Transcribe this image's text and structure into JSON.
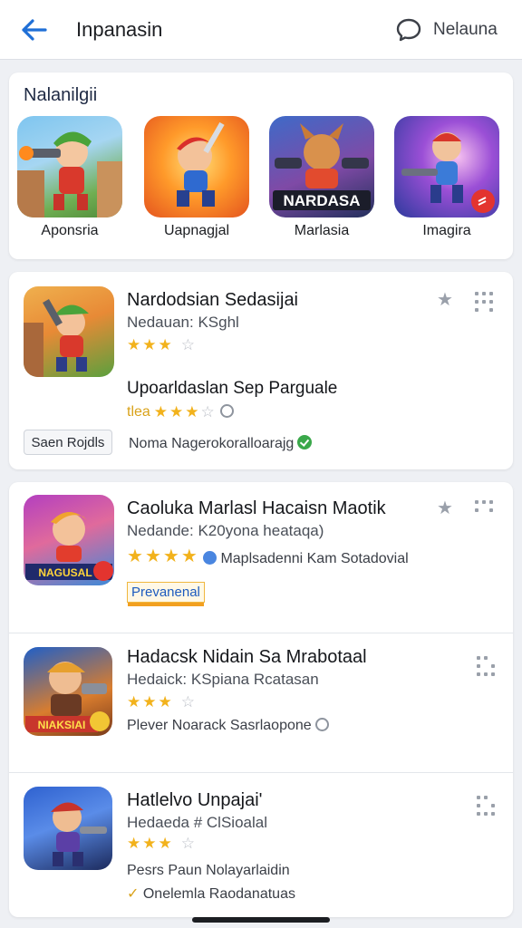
{
  "header": {
    "title": "Inpanasin",
    "right_label": "Nelauna"
  },
  "featured": {
    "title": "Nalanilgii",
    "items": [
      {
        "label": "Aponsria"
      },
      {
        "label": "Uapnagjal"
      },
      {
        "label": "Marlasia",
        "icon_text": "NARDASA"
      },
      {
        "label": "Imagira"
      }
    ]
  },
  "apps": [
    {
      "name": "Nardodsian Sedasijai",
      "subtitle": "Nedauan: KSghl",
      "rating": 3,
      "update_title": "Upoarldaslan Sep Parguale",
      "update_rating_label": "tlea",
      "update_rating": 3,
      "button_label": "Saen Rojdls",
      "note": "Noma Nagerokoralloarajg"
    },
    {
      "name": "Caoluka Marlasl Hacaisn Maotik",
      "subtitle": "Nedande: K20yona heataqa)",
      "rating": 4,
      "meta": "Maplsadenni Kam Sotadovial",
      "badge": "Prevanenal",
      "icon_text": "NAGUSAL"
    },
    {
      "name": "Hadacsk Nidain Sa Mrabotaal",
      "subtitle": "Hedaick: KSpiana Rcatasan",
      "rating": 3,
      "meta": "Plever Noarack Sasrlaopone",
      "icon_text": "NIAKSIAI"
    },
    {
      "name": "Hatlelvo Unpajai'",
      "subtitle": "Hedaeda # ClSioalal",
      "rating": 3,
      "meta": "Pesrs Paun Nolayarlaidin",
      "meta2": "Onelemla Raodanatuas"
    }
  ]
}
